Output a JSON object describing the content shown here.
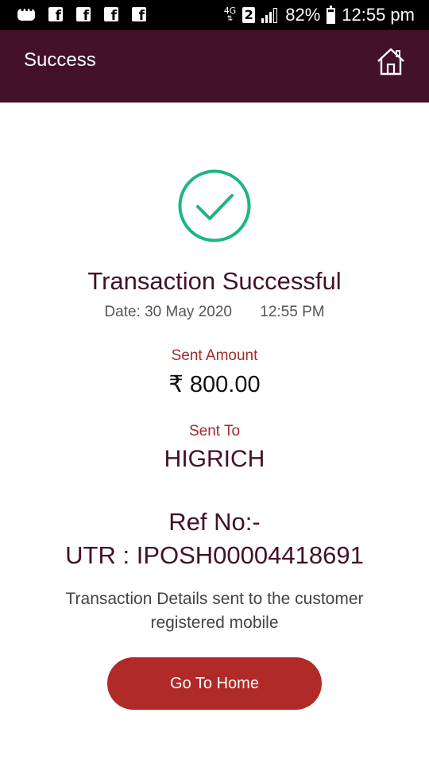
{
  "status_bar": {
    "network": "4G",
    "sim_slot": "2",
    "battery": "82%",
    "battery_level": 0.82,
    "time": "12:55 pm",
    "notification_icons": [
      "chat-icon",
      "facebook-icon",
      "facebook-icon",
      "facebook-icon",
      "facebook-icon"
    ]
  },
  "header": {
    "title": "Success",
    "home_icon": "home-icon"
  },
  "result": {
    "status_icon": "check-circle-icon",
    "title": "Transaction Successful",
    "date_label": "Date:",
    "date": "30 May 2020",
    "time": "12:55 PM",
    "sent_amount_label": "Sent Amount",
    "amount": "₹ 800.00",
    "sent_to_label": "Sent To",
    "recipient": "HIGRICH",
    "ref_label": "Ref No:-",
    "utr": "UTR : IPOSH00004418691",
    "note": "Transaction Details sent to the customer registered mobile"
  },
  "actions": {
    "go_home_label": "Go To Home"
  },
  "colors": {
    "app_bar": "#431128",
    "accent_red": "#a52a2a",
    "button": "#b02a27",
    "success_green": "#1bb77f"
  }
}
